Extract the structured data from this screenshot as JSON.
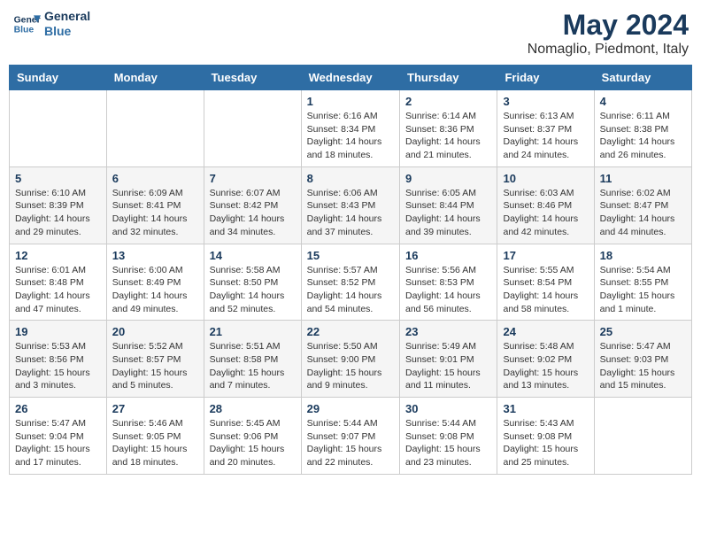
{
  "logo": {
    "line1": "General",
    "line2": "Blue"
  },
  "title": "May 2024",
  "subtitle": "Nomaglio, Piedmont, Italy",
  "days_header": [
    "Sunday",
    "Monday",
    "Tuesday",
    "Wednesday",
    "Thursday",
    "Friday",
    "Saturday"
  ],
  "weeks": [
    [
      {
        "day": "",
        "info": ""
      },
      {
        "day": "",
        "info": ""
      },
      {
        "day": "",
        "info": ""
      },
      {
        "day": "1",
        "info": "Sunrise: 6:16 AM\nSunset: 8:34 PM\nDaylight: 14 hours\nand 18 minutes."
      },
      {
        "day": "2",
        "info": "Sunrise: 6:14 AM\nSunset: 8:36 PM\nDaylight: 14 hours\nand 21 minutes."
      },
      {
        "day": "3",
        "info": "Sunrise: 6:13 AM\nSunset: 8:37 PM\nDaylight: 14 hours\nand 24 minutes."
      },
      {
        "day": "4",
        "info": "Sunrise: 6:11 AM\nSunset: 8:38 PM\nDaylight: 14 hours\nand 26 minutes."
      }
    ],
    [
      {
        "day": "5",
        "info": "Sunrise: 6:10 AM\nSunset: 8:39 PM\nDaylight: 14 hours\nand 29 minutes."
      },
      {
        "day": "6",
        "info": "Sunrise: 6:09 AM\nSunset: 8:41 PM\nDaylight: 14 hours\nand 32 minutes."
      },
      {
        "day": "7",
        "info": "Sunrise: 6:07 AM\nSunset: 8:42 PM\nDaylight: 14 hours\nand 34 minutes."
      },
      {
        "day": "8",
        "info": "Sunrise: 6:06 AM\nSunset: 8:43 PM\nDaylight: 14 hours\nand 37 minutes."
      },
      {
        "day": "9",
        "info": "Sunrise: 6:05 AM\nSunset: 8:44 PM\nDaylight: 14 hours\nand 39 minutes."
      },
      {
        "day": "10",
        "info": "Sunrise: 6:03 AM\nSunset: 8:46 PM\nDaylight: 14 hours\nand 42 minutes."
      },
      {
        "day": "11",
        "info": "Sunrise: 6:02 AM\nSunset: 8:47 PM\nDaylight: 14 hours\nand 44 minutes."
      }
    ],
    [
      {
        "day": "12",
        "info": "Sunrise: 6:01 AM\nSunset: 8:48 PM\nDaylight: 14 hours\nand 47 minutes."
      },
      {
        "day": "13",
        "info": "Sunrise: 6:00 AM\nSunset: 8:49 PM\nDaylight: 14 hours\nand 49 minutes."
      },
      {
        "day": "14",
        "info": "Sunrise: 5:58 AM\nSunset: 8:50 PM\nDaylight: 14 hours\nand 52 minutes."
      },
      {
        "day": "15",
        "info": "Sunrise: 5:57 AM\nSunset: 8:52 PM\nDaylight: 14 hours\nand 54 minutes."
      },
      {
        "day": "16",
        "info": "Sunrise: 5:56 AM\nSunset: 8:53 PM\nDaylight: 14 hours\nand 56 minutes."
      },
      {
        "day": "17",
        "info": "Sunrise: 5:55 AM\nSunset: 8:54 PM\nDaylight: 14 hours\nand 58 minutes."
      },
      {
        "day": "18",
        "info": "Sunrise: 5:54 AM\nSunset: 8:55 PM\nDaylight: 15 hours\nand 1 minute."
      }
    ],
    [
      {
        "day": "19",
        "info": "Sunrise: 5:53 AM\nSunset: 8:56 PM\nDaylight: 15 hours\nand 3 minutes."
      },
      {
        "day": "20",
        "info": "Sunrise: 5:52 AM\nSunset: 8:57 PM\nDaylight: 15 hours\nand 5 minutes."
      },
      {
        "day": "21",
        "info": "Sunrise: 5:51 AM\nSunset: 8:58 PM\nDaylight: 15 hours\nand 7 minutes."
      },
      {
        "day": "22",
        "info": "Sunrise: 5:50 AM\nSunset: 9:00 PM\nDaylight: 15 hours\nand 9 minutes."
      },
      {
        "day": "23",
        "info": "Sunrise: 5:49 AM\nSunset: 9:01 PM\nDaylight: 15 hours\nand 11 minutes."
      },
      {
        "day": "24",
        "info": "Sunrise: 5:48 AM\nSunset: 9:02 PM\nDaylight: 15 hours\nand 13 minutes."
      },
      {
        "day": "25",
        "info": "Sunrise: 5:47 AM\nSunset: 9:03 PM\nDaylight: 15 hours\nand 15 minutes."
      }
    ],
    [
      {
        "day": "26",
        "info": "Sunrise: 5:47 AM\nSunset: 9:04 PM\nDaylight: 15 hours\nand 17 minutes."
      },
      {
        "day": "27",
        "info": "Sunrise: 5:46 AM\nSunset: 9:05 PM\nDaylight: 15 hours\nand 18 minutes."
      },
      {
        "day": "28",
        "info": "Sunrise: 5:45 AM\nSunset: 9:06 PM\nDaylight: 15 hours\nand 20 minutes."
      },
      {
        "day": "29",
        "info": "Sunrise: 5:44 AM\nSunset: 9:07 PM\nDaylight: 15 hours\nand 22 minutes."
      },
      {
        "day": "30",
        "info": "Sunrise: 5:44 AM\nSunset: 9:08 PM\nDaylight: 15 hours\nand 23 minutes."
      },
      {
        "day": "31",
        "info": "Sunrise: 5:43 AM\nSunset: 9:08 PM\nDaylight: 15 hours\nand 25 minutes."
      },
      {
        "day": "",
        "info": ""
      }
    ]
  ]
}
